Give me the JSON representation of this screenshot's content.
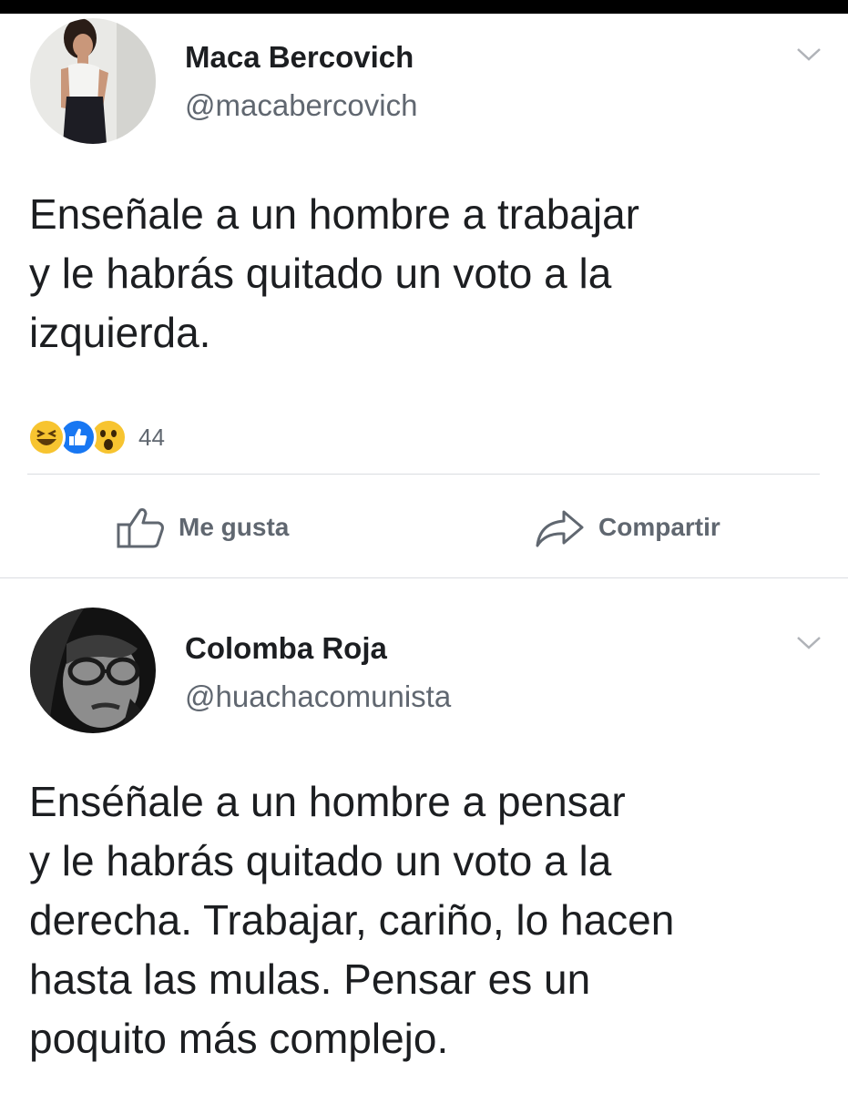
{
  "posts": [
    {
      "author": {
        "name": "Maca Bercovich",
        "handle": "@macabercovich"
      },
      "text_lines": [
        "Enseñale a un hombre a trabajar",
        "y le habrás quitado un voto a la",
        "izquierda."
      ],
      "reactions": {
        "icons": [
          "laughing-emoji-icon",
          "like-reaction-icon",
          "wow-emoji-icon"
        ],
        "count": "44"
      },
      "actions": {
        "like_label": "Me gusta",
        "share_label": "Compartir"
      }
    },
    {
      "author": {
        "name": "Colomba Roja",
        "handle": "@huachacomunista"
      },
      "text_lines": [
        "Enséñale a un hombre a pensar",
        "y le habrás quitado un voto a la",
        "derecha. Trabajar, cariño, lo hacen",
        "hasta las mulas. Pensar es un",
        "poquito más complejo."
      ]
    }
  ],
  "colors": {
    "text": "#1c1e21",
    "secondary": "#606770",
    "like_blue": "#1877f2",
    "emoji_yellow": "#f7c430"
  }
}
